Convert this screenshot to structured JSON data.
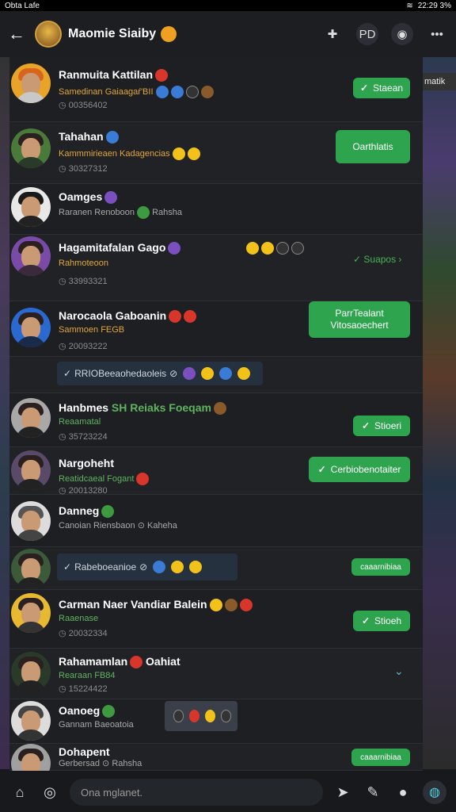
{
  "status": {
    "left": "Obta Lafe",
    "right": "22:29 3%"
  },
  "header": {
    "title": "Maomie Siaiby",
    "action_label": "PD"
  },
  "edge_label": "matik",
  "rows": [
    {
      "name": "Ranmuita Kattilan",
      "sub": "Samedinan Gaiaagaŕ'BII",
      "meta": "00356402",
      "button": "Staean"
    },
    {
      "name": "Tahahan",
      "sub": "Kammmirieaen Kadagencias",
      "meta": "30327312",
      "button": "Oarthlatis"
    },
    {
      "name": "Oamges",
      "sub": "Raranen Renoboon",
      "sub2": "Rahsha",
      "meta": ""
    },
    {
      "name": "Hagamitafalan Gago",
      "sub": "Rahmoteoon",
      "meta": "33993321",
      "link": "Suapos"
    },
    {
      "name": "Narocaola Gaboanin",
      "sub": "Sammoen FEGB",
      "meta": "20093222",
      "button": "ParrTealant Vitosaoechert"
    },
    {
      "name": "",
      "media": "RRIOBeeaohedaoleis"
    },
    {
      "name": "Hanbmes",
      "name_extra": "SH Reiaks Foeqam",
      "sub": "Reaamatal",
      "meta": "35723224",
      "button": "Stioeri"
    },
    {
      "name": "Nargoheht",
      "sub": "Reatidcaeal Fogant",
      "meta": "20013280",
      "button": "Cerbiobenotaiter"
    },
    {
      "name": "Danneg",
      "sub": "Canoian Riensbaon",
      "sub2": "Kaheha",
      "meta": ""
    },
    {
      "name": "",
      "media": "Rabeboeanioe",
      "chip": "caaarnibiaa"
    },
    {
      "name": "Carman Naer Vandiar Balein",
      "sub": "Raaenase",
      "meta": "20032334",
      "button": "Stioeh"
    },
    {
      "name": "Rahamamlan",
      "name_extra": "Oahiat",
      "sub": "Rearaan FB84",
      "meta": "15224422"
    },
    {
      "name": "Oanoeg",
      "sub": "Gannam Baeoatoia",
      "meta": ""
    },
    {
      "name": "Dohapent",
      "sub": "Gerbersad",
      "sub2": "Rahsha",
      "chip": "caaarnibiaa"
    }
  ],
  "input": {
    "placeholder": "Ona mglanet."
  },
  "colors": {
    "accent": "#2ea44f",
    "background": "#1d1f23",
    "header": "#1c1e22"
  }
}
